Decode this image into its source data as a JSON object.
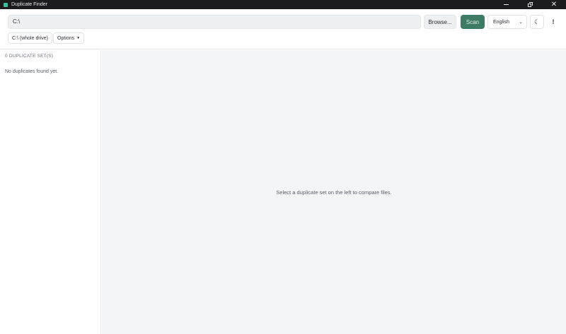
{
  "window": {
    "title": "Duplicate Finder",
    "icon": "app-icon"
  },
  "toolbar": {
    "path_value": "C:\\",
    "browse_label": "Browse...",
    "scan_label": "Scan",
    "language_selected": "English",
    "theme_icon": "moon-icon",
    "info_icon": "info-icon",
    "drive_chip_label": "C:\\ (whole drive)",
    "options_label": "Options"
  },
  "sidebar": {
    "count_label": "0 DUPLICATE SET(S)",
    "empty_text": "No duplicates found yet."
  },
  "main": {
    "hint": "Select a duplicate set on the left to compare files."
  },
  "colors": {
    "titlebar": "#1c1c1e",
    "accent": "#3e7b65",
    "main_bg": "#f4f5f7"
  }
}
